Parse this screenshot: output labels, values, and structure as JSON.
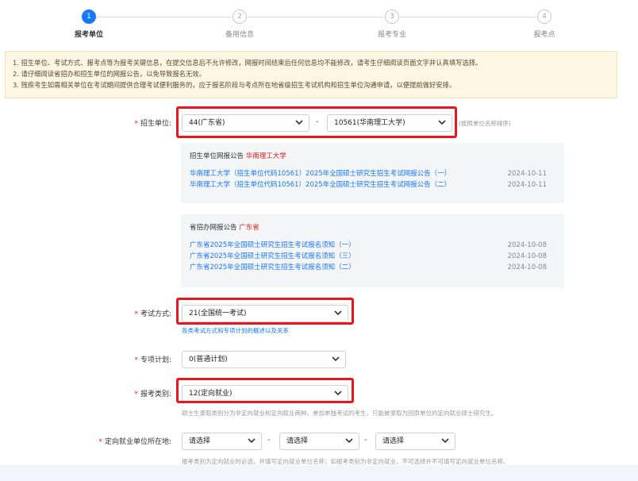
{
  "steps": [
    {
      "num": "1",
      "label": "报考单位"
    },
    {
      "num": "2",
      "label": "备用信息"
    },
    {
      "num": "3",
      "label": "报考专业"
    },
    {
      "num": "4",
      "label": "报考点"
    }
  ],
  "notice": [
    "1. 招生单位、考试方式、报考点等为报考关键信息，在提交信息后不允许修改，网报时间结束后任何信息均不能修改，请考生仔细阅读页面文字并认真填写选择。",
    "2. 请仔细阅读省招办和招生单位的网报公告，以免导致报名无效。",
    "3. 残疾考生如需相关单位在考试期间提供合理考试便利服务的，应于报名阶段与考点所在地省级招生考试机构和招生单位沟通申请，以便提前做好安排。"
  ],
  "form": {
    "unit": {
      "label": "招生单位:",
      "province": "44(广东省)",
      "school": "10561(华南理工大学)",
      "hint": "(按照单位名称排序)"
    },
    "unit_panel": {
      "title": "招生单位网报公告",
      "title_red": "华南理工大学",
      "items": [
        {
          "text": "华南理工大学（招生单位代码10561）2025年全国硕士研究生招生考试网报公告（一）",
          "date": "2024-10-11"
        },
        {
          "text": "华南理工大学（招生单位代码10561）2025年全国硕士研究生招生考试网报公告（二）",
          "date": "2024-10-11"
        }
      ]
    },
    "prov_panel": {
      "title": "省招办网报公告",
      "title_red": "广东省",
      "items": [
        {
          "text": "广东省2025年全国硕士研究生招生考试报名须知（一）",
          "date": "2024-10-08"
        },
        {
          "text": "广东省2025年全国硕士研究生招生考试报名须知（三）",
          "date": "2024-10-08"
        },
        {
          "text": "广东省2025年全国硕士研究生招生考试报名须知（二）",
          "date": "2024-10-08"
        }
      ]
    },
    "exam_mode": {
      "label": "考试方式:",
      "value": "21(全国统一考试)",
      "link": "各类考试方式和专项计划的概述以及关系"
    },
    "special_plan": {
      "label": "专项计划:",
      "value": "0(普通计划)"
    },
    "category": {
      "label": "报考类别:",
      "value": "12(定向就业)",
      "hint": "硕士生录取类别分为非定向就业和定向就业两种。参加单独考试的考生，只能被录取为回原单位的定向就业硕士研究生。"
    },
    "directed_location": {
      "label": "定向就业单位所在地:",
      "sel1": "请选择",
      "sel2": "请选择",
      "sel3": "请选择",
      "hint": "报考类别为定向就业时必选，并填写定向就业单位名称；如报考类别为非定向就业，不可选择并不可填写定向就业单位名称。"
    },
    "dash": "-"
  },
  "colors": {
    "accent": "#1677ff",
    "highlight_box": "#e8171d",
    "required": "#e02020",
    "notice_bg": "#fdf6e4"
  }
}
